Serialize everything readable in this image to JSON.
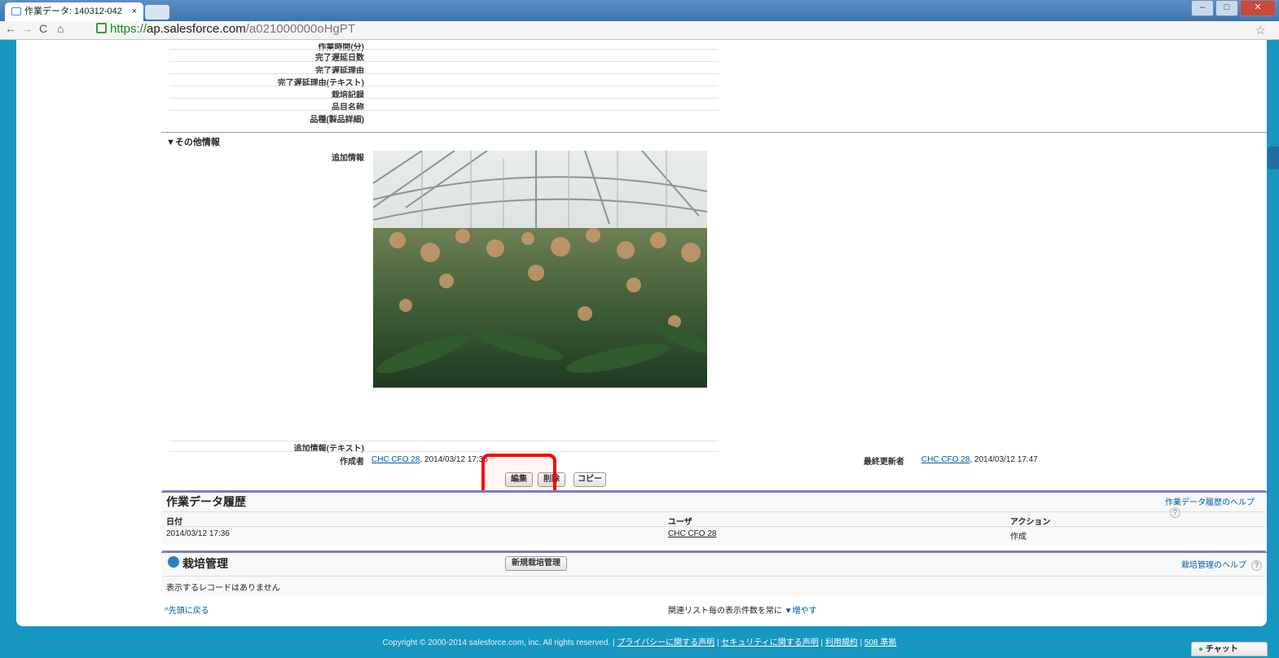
{
  "browser": {
    "tab_title": "作業データ: 140312-042",
    "tab_close": "×",
    "url_proto": "https://",
    "url_host": "ap.salesforce.com",
    "url_path": "/a021000000oHgPT"
  },
  "detail": {
    "fields_top": [
      {
        "label": "作業時間(分)"
      },
      {
        "label": "完了遅延日数"
      },
      {
        "label": "完了遅延理由"
      },
      {
        "label": "完了遅延理由(テキスト)"
      },
      {
        "label": "栽培記録"
      },
      {
        "label": "品目名称"
      },
      {
        "label": "品種(製品詳細)"
      }
    ],
    "section_other": "▼その他情報",
    "extra_info_label": "追加情報",
    "extra_text_label": "追加情報(テキスト)",
    "created_by_label": "作成者",
    "created_by_user": "CHC CFO 28",
    "created_by_date": ", 2014/03/12 17:36",
    "modified_by_label": "最終更新者",
    "modified_by_user": "CHC CFO 28",
    "modified_by_date": ", 2014/03/12 17:47"
  },
  "buttons": {
    "edit": "編集",
    "delete": "削除",
    "copy": "コピー"
  },
  "history": {
    "title": "作業データ履歴",
    "help": "作業データ履歴のヘルプ",
    "col_date": "日付",
    "col_user": "ユーザ",
    "col_action": "アクション",
    "rows": [
      {
        "date": "2014/03/12 17:36",
        "user": "CHC CFO 28",
        "action": "作成"
      }
    ]
  },
  "cultivation": {
    "title": "栽培管理",
    "new_button": "新規栽培管理",
    "help": "栽培管理のヘルプ",
    "empty": "表示するレコードはありません"
  },
  "bottom": {
    "back_to_top": "^先頭に戻る",
    "related_text": "関連リスト毎の表示件数を常に",
    "increase": "▼増やす"
  },
  "footer": {
    "copyright": "Copyright © 2000-2014 salesforce.com, inc. All rights reserved. | ",
    "privacy": "プライバシーに関する声明",
    "security": "セキュリティに関する声明",
    "terms": "利用規約",
    "accessibility": "508 準拠",
    "sep": " | "
  },
  "chat": "チャット",
  "colors": {
    "page_bg": "#1797c0",
    "link": "#015ba7",
    "highlight": "#ff0000"
  }
}
